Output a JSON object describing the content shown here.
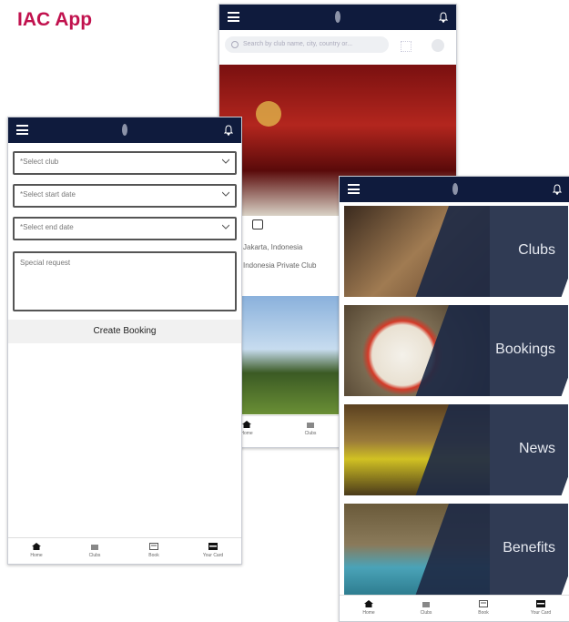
{
  "page": {
    "title": "IAC App"
  },
  "booking_screen": {
    "select_club": "*Select club",
    "select_start": "*Select start date",
    "select_end": "*Select end date",
    "special_request": "Special request",
    "create_button": "Create Booking"
  },
  "clubs_screen": {
    "search_placeholder": "Search by club name, city, country or...",
    "location_text": "Jakarta, Indonesia",
    "club_text": "Indonesia Private Club"
  },
  "nav": {
    "home": "Home",
    "clubs": "Clubs",
    "book": "Book",
    "your_card": "Your Card"
  },
  "menu_screen": {
    "cards": [
      {
        "label": "Clubs"
      },
      {
        "label": "Bookings"
      },
      {
        "label": "News"
      },
      {
        "label": "Benefits"
      }
    ]
  },
  "colors": {
    "title": "#c1124e",
    "topbar": "#0f1b3d",
    "card_overlay": "#1e2a45"
  }
}
